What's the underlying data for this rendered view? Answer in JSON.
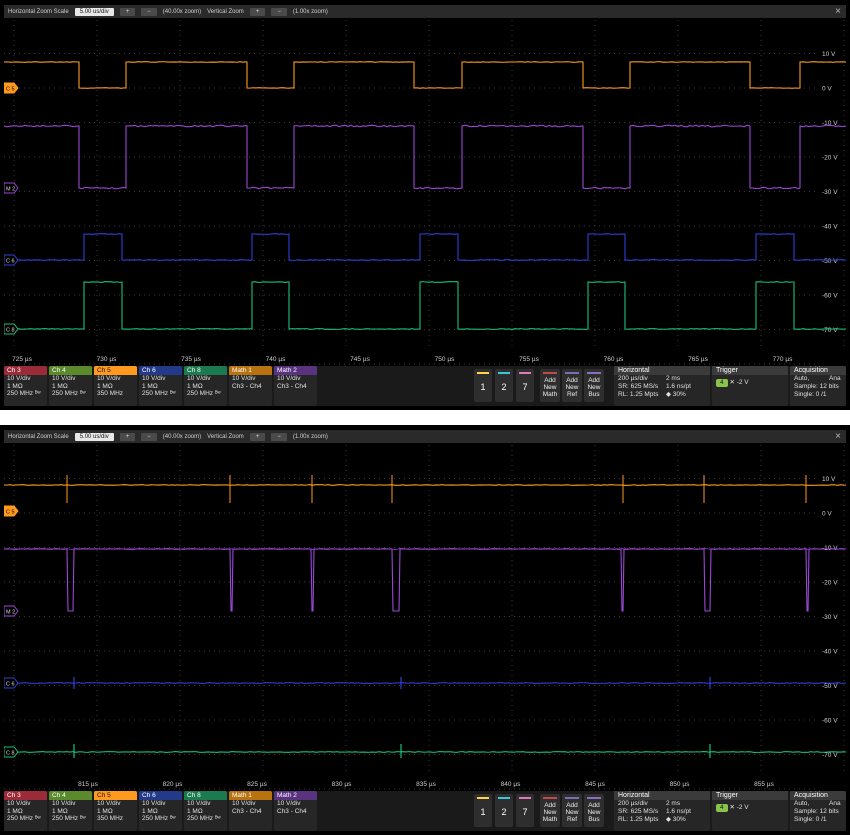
{
  "zoom": {
    "hz_label": "Horizontal Zoom Scale",
    "hz_value": "5.00 us/div",
    "hz_factor": "(40.00x zoom)",
    "vz_label": "Vertical Zoom",
    "vz_factor": "(1.00x zoom)",
    "close": "×"
  },
  "colors": {
    "ch5": "#ff9a1f",
    "math2": "#9b47d6",
    "ch6": "#2f3fd6",
    "ch8": "#19c27a",
    "ch3": "#9c2b3a",
    "ch4": "#5a8a2a",
    "math1": "#b8720f"
  },
  "volt_labels": [
    "10 V",
    "0 V",
    "-10 V",
    "-20 V",
    "-30 V",
    "-40 V",
    "-50 V",
    "-60 V",
    "-70 V"
  ],
  "trace_labels": {
    "c5": "C 5",
    "m2": "M 2",
    "c6": "C 6",
    "c8": "C 8"
  },
  "top": {
    "time_ticks": [
      "725 µs",
      "730 µs",
      "735 µs",
      "740 µs",
      "745 µs",
      "750 µs",
      "755 µs",
      "760 µs",
      "765 µs",
      "770 µs"
    ]
  },
  "bottom": {
    "time_ticks": [
      "815 µs",
      "820 µs",
      "825 µs",
      "830 µs",
      "835 µs",
      "840 µs",
      "845 µs",
      "850 µs",
      "855 µs"
    ]
  },
  "channels": [
    {
      "id": "ch3",
      "header": "Ch 3",
      "l1": "10 V/div",
      "l2": "1 MΩ",
      "l3": "250 MHz ᴮʷ"
    },
    {
      "id": "ch4",
      "header": "Ch 4",
      "l1": "10 V/div",
      "l2": "1 MΩ",
      "l3": "250 MHz ᴮʷ"
    },
    {
      "id": "ch5",
      "header": "Ch 5",
      "l1": "10 V/div",
      "l2": "1 MΩ",
      "l3": "350 MHz"
    },
    {
      "id": "ch6",
      "header": "Ch 6",
      "l1": "10 V/div",
      "l2": "1 MΩ",
      "l3": "250 MHz ᴮʷ"
    },
    {
      "id": "ch8",
      "header": "Ch 8",
      "l1": "10 V/div",
      "l2": "1 MΩ",
      "l3": "250 MHz ᴮʷ"
    },
    {
      "id": "math1",
      "header": "Math 1",
      "l1": "10 V/div",
      "l2": "Ch3 - Ch4",
      "l3": ""
    },
    {
      "id": "math2",
      "header": "Math 2",
      "l1": "10 V/div",
      "l2": "Ch3 - Ch4",
      "l3": ""
    }
  ],
  "num_buttons": [
    "1",
    "2",
    "7"
  ],
  "add_buttons": [
    {
      "l1": "Add",
      "l2": "New",
      "l3": "Math"
    },
    {
      "l1": "Add",
      "l2": "New",
      "l3": "Ref"
    },
    {
      "l1": "Add",
      "l2": "New",
      "l3": "Bus"
    }
  ],
  "horizontal": {
    "title": "Horizontal",
    "scale": "200 µs/div",
    "sr": "SR: 625 MS/s",
    "rl": "RL: 1.25 Mpts",
    "pos": "2 ms",
    "res": "1.6 ns/pt",
    "pct": "30%"
  },
  "trigger": {
    "title": "Trigger",
    "source": "4",
    "level": "-2 V"
  },
  "acquisition": {
    "title": "Acquisition",
    "mode": "Auto,",
    "extra": "Ana",
    "sample": "Sample: 12 bits",
    "single": "Single: 0 /1"
  }
}
